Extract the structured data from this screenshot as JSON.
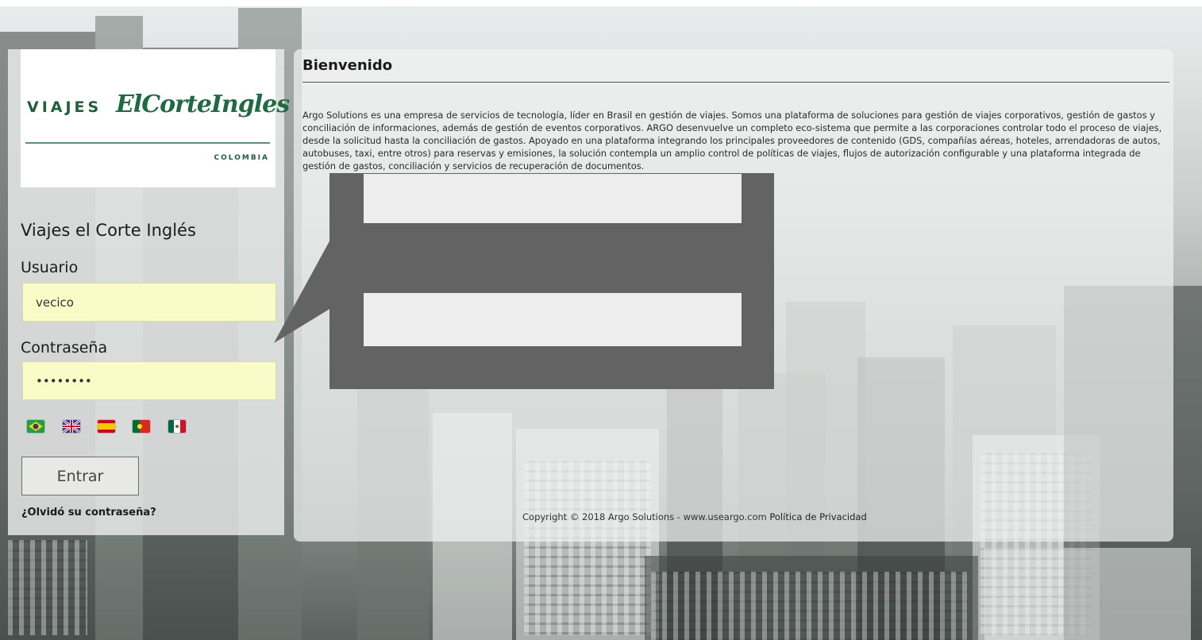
{
  "brand": {
    "logo_viajes": "VIAJES",
    "logo_eci": "ElCorteIngles",
    "logo_colombia": "COLOMBIA",
    "heading": "Viajes el Corte Inglés"
  },
  "login": {
    "usuario_label": "Usuario",
    "usuario_value": "vecico",
    "contrasena_label": "Contraseña",
    "contrasena_value": "••••••••",
    "languages": [
      "brazil-flag-icon",
      "uk-flag-icon",
      "spain-flag-icon",
      "portugal-flag-icon",
      "mexico-flag-icon"
    ],
    "submit_label": "Entrar",
    "forgot_label": "¿Olvidó su contraseña?"
  },
  "main": {
    "title": "Bienvenido",
    "body": "Argo Solutions es una empresa de servicios de tecnología, líder en Brasil en gestión de viajes. Somos una plataforma de soluciones para gestión de viajes corporativos, gestión de gastos y conciliación de informaciones, además de gestión de eventos corporativos. ARGO desenvuelve un completo eco-sistema que permite a las corporaciones controlar todo el proceso de viajes, desde la solicitud hasta la conciliación de gastos. Apoyado en una plataforma integrando los principales proveedores de contenido (GDS, compañías aéreas, hoteles, arrendadoras de autos, autobuses, taxi, entre otros) para reservas y emisiones, la solución contempla un amplio control de políticas de viajes, flujos de autorización configurable y una plataforma integrada de gestión de gastos, conciliación y servicios de recuperación de documentos."
  },
  "footer": {
    "copyright": "Copyright © 2018 Argo Solutions - www.useargo.com",
    "privacy": "Política de Privacidad"
  },
  "colors": {
    "brand_green": "#1f6a43",
    "input_bg": "#fafcc8",
    "callout": "#636363",
    "redaction": "#ededed"
  }
}
